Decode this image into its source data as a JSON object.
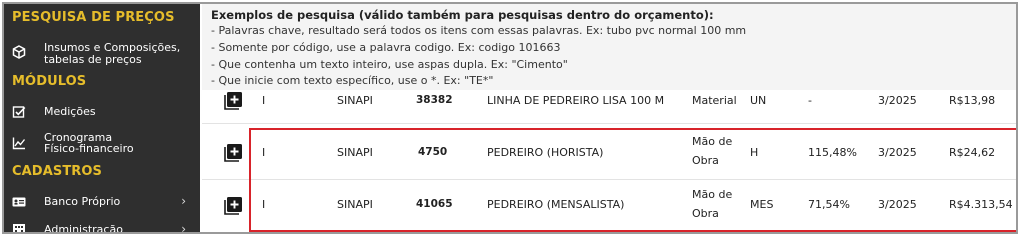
{
  "sidebar": {
    "sections": {
      "pesquisa": "PESQUISA DE PREÇOS",
      "modulos": "MÓDULOS",
      "cadastros": "CADASTROS"
    },
    "items": [
      {
        "icon": "cube-icon",
        "label_line1": "Insumos e Composições,",
        "label_line2": "tabelas de preços"
      },
      {
        "icon": "checkbox-icon",
        "label_line1": "Medições"
      },
      {
        "icon": "chart-line-icon",
        "label_line1": "Cronograma",
        "label_line2": "Físico-financeiro"
      },
      {
        "icon": "id-card-icon",
        "label_line1": "Banco Próprio"
      },
      {
        "icon": "building-icon",
        "label_line1": "Administração"
      }
    ]
  },
  "hint": {
    "title": "Exemplos de pesquisa (válido também para pesquisas dentro do orçamento):",
    "lines": [
      "- Palavras chave, resultado será todos os itens com essas palavras. Ex: tubo pvc normal 100 mm",
      "- Somente por código, use a palavra codigo. Ex: codigo 101663",
      "- Que contenha um texto inteiro, use aspas dupla. Ex: \"Cimento\"",
      "- Que inicie com texto específico, use o *. Ex: \"TE*\""
    ]
  },
  "rows": [
    {
      "tipo": "I",
      "fonte": "SINAPI",
      "codigo": "38382",
      "descricao": "LINHA DE PEDREIRO LISA 100 M",
      "classe": "Material",
      "unidade": "UN",
      "encargos": "-",
      "data": "3/2025",
      "preco": "R$13,98"
    },
    {
      "tipo": "I",
      "fonte": "SINAPI",
      "codigo": "4750",
      "descricao": "PEDREIRO (HORISTA)",
      "classe_line1": "Mão de",
      "classe_line2": "Obra",
      "unidade": "H",
      "encargos": "115,48%",
      "data": "3/2025",
      "preco": "R$24,62"
    },
    {
      "tipo": "I",
      "fonte": "SINAPI",
      "codigo": "41065",
      "descricao": "PEDREIRO (MENSALISTA)",
      "classe_line1": "Mão de",
      "classe_line2": "Obra",
      "unidade": "MES",
      "encargos": "71,54%",
      "data": "3/2025",
      "preco": "R$4.313,54"
    }
  ],
  "colors": {
    "sidebar_bg": "#2f2f2f",
    "section": "#e6bd2b",
    "highlight": "#d8232a"
  }
}
